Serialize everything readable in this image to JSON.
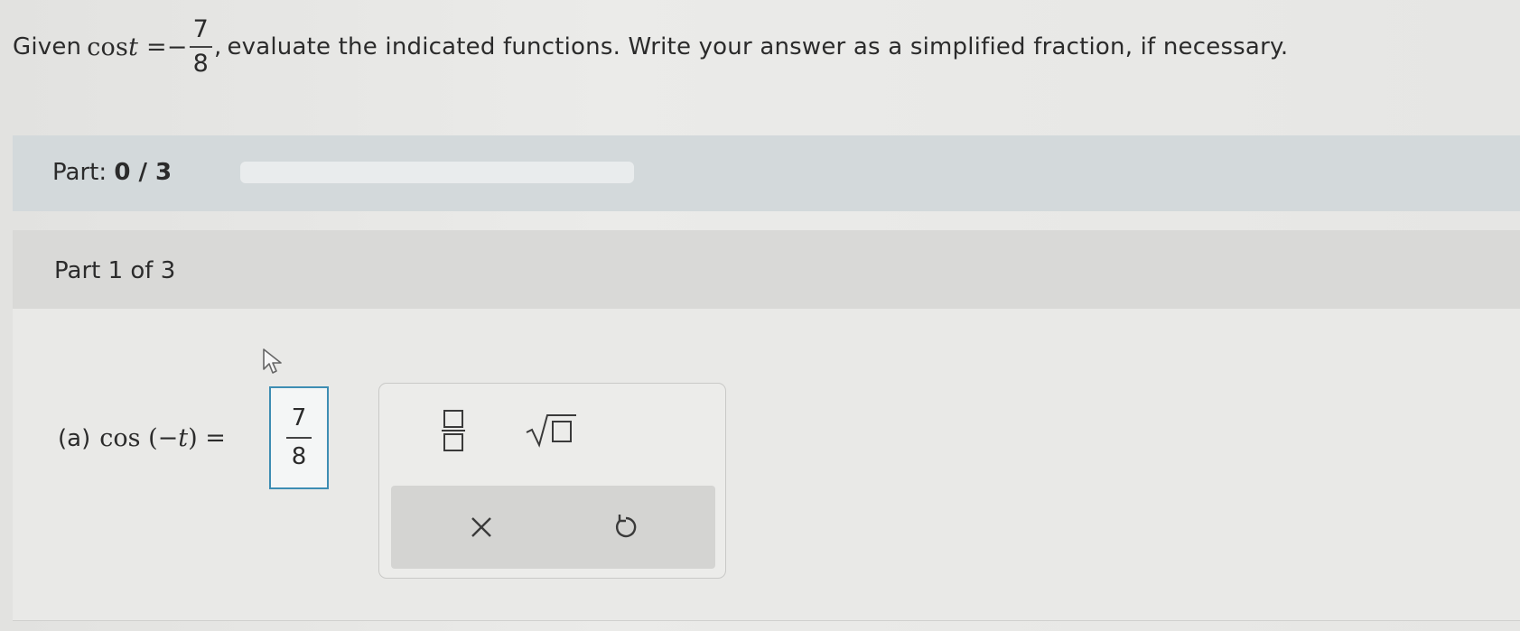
{
  "question": {
    "prefix": "Given",
    "func": "cos",
    "var": "t",
    "equals": "=",
    "sign": "−",
    "numerator": "7",
    "denominator": "8",
    "comma": ",",
    "instruction": "evaluate the indicated functions. Write your answer as a simplified fraction, if necessary."
  },
  "part_bar": {
    "label": "Part:",
    "progress_text": "0 / 3",
    "progress_fraction": 0
  },
  "section": {
    "title": "Part 1 of 3"
  },
  "item_a": {
    "label": "(a)",
    "func": "cos",
    "open_paren": "(",
    "arg": "−t",
    "close_paren": ")",
    "equals": "="
  },
  "answer": {
    "numerator": "7",
    "denominator": "8"
  },
  "palette": {
    "icons": [
      "fraction-template-icon",
      "square-root-template-icon",
      "clear-icon",
      "undo-icon"
    ]
  },
  "colors": {
    "answer_border": "#3d8db3",
    "part_bar_bg": "#d3d9db"
  }
}
